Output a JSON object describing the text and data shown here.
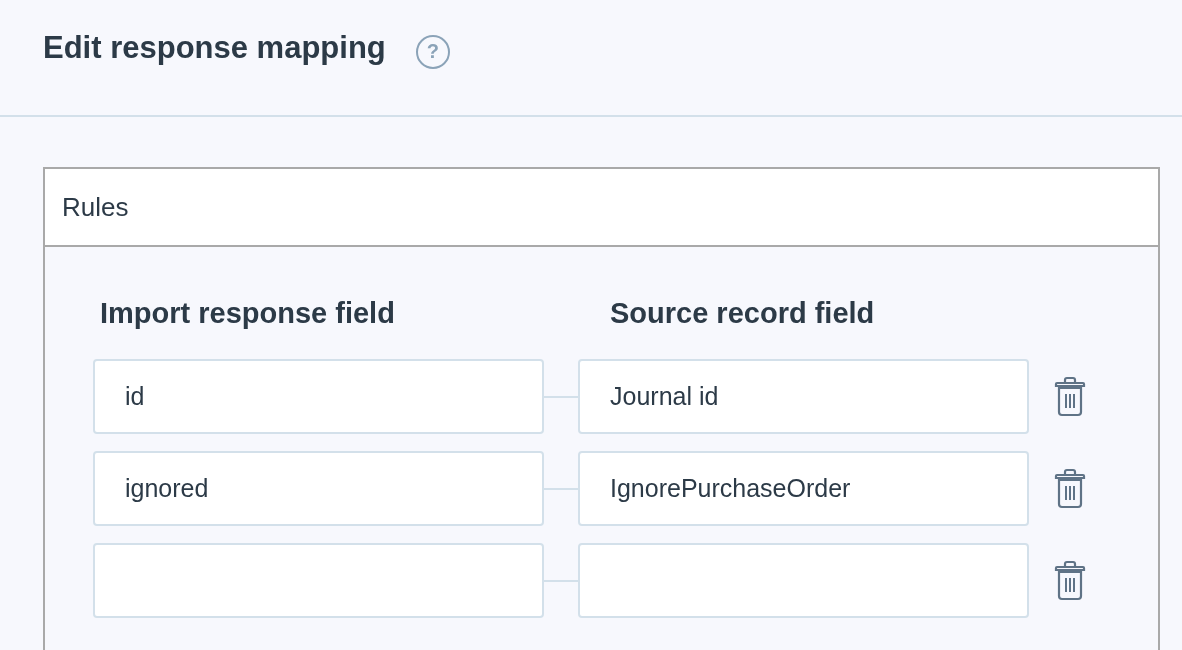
{
  "header": {
    "title": "Edit response mapping",
    "help_icon": "?"
  },
  "panel": {
    "title": "Rules",
    "columns": [
      "Import response field",
      "Source record field"
    ],
    "rows": [
      {
        "import_field": "id",
        "source_field": "Journal id"
      },
      {
        "import_field": "ignored",
        "source_field": "IgnorePurchaseOrder"
      },
      {}
    ]
  }
}
